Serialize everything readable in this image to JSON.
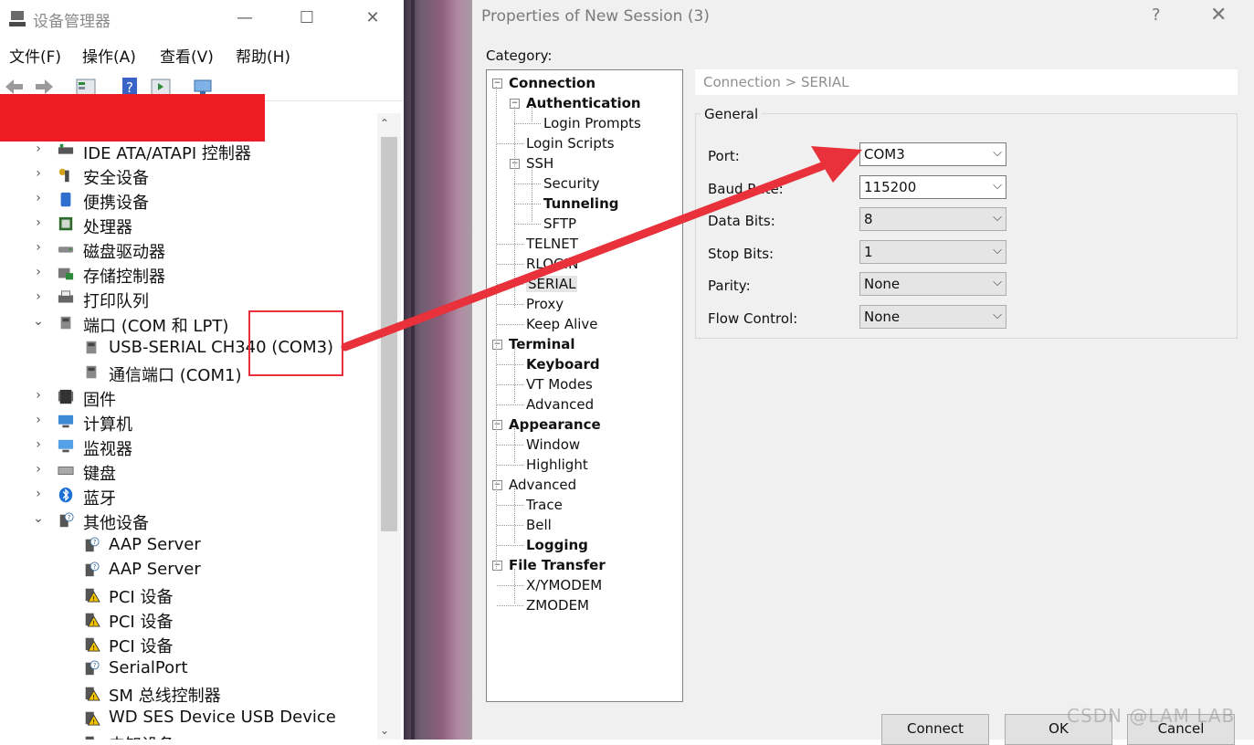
{
  "device_manager": {
    "title": "设备管理器",
    "window_buttons": {
      "minimize": "—",
      "maximize": "☐",
      "close": "✕"
    },
    "menu": [
      "文件(F)",
      "操作(A)",
      "查看(V)",
      "帮助(H)"
    ],
    "tree": [
      {
        "label": "IDE ATA/ATAPI 控制器",
        "expander": "›",
        "icon": "ide-controller-icon"
      },
      {
        "label": "安全设备",
        "expander": "›",
        "icon": "security-key-icon"
      },
      {
        "label": "便携设备",
        "expander": "›",
        "icon": "portable-device-icon"
      },
      {
        "label": "处理器",
        "expander": "›",
        "icon": "processor-icon"
      },
      {
        "label": "磁盘驱动器",
        "expander": "›",
        "icon": "disk-drive-icon"
      },
      {
        "label": "存储控制器",
        "expander": "›",
        "icon": "storage-controller-icon"
      },
      {
        "label": "打印队列",
        "expander": "›",
        "icon": "printer-icon"
      },
      {
        "label": "端口 (COM 和 LPT)",
        "expander": "⌄",
        "icon": "port-icon"
      },
      {
        "label": "USB-SERIAL CH340 (COM3)",
        "expander": "",
        "icon": "port-icon"
      },
      {
        "label": "通信端口 (COM1)",
        "expander": "",
        "icon": "port-icon"
      },
      {
        "label": "固件",
        "expander": "›",
        "icon": "firmware-icon"
      },
      {
        "label": "计算机",
        "expander": "›",
        "icon": "computer-icon"
      },
      {
        "label": "监视器",
        "expander": "›",
        "icon": "monitor-icon"
      },
      {
        "label": "键盘",
        "expander": "›",
        "icon": "keyboard-icon"
      },
      {
        "label": "蓝牙",
        "expander": "›",
        "icon": "bluetooth-icon"
      },
      {
        "label": "其他设备",
        "expander": "⌄",
        "icon": "unknown-device-icon"
      },
      {
        "label": "AAP Server",
        "expander": "",
        "icon": "unknown-device-icon"
      },
      {
        "label": "AAP Server",
        "expander": "",
        "icon": "unknown-device-icon"
      },
      {
        "label": "PCI 设备",
        "expander": "",
        "icon": "warning-device-icon"
      },
      {
        "label": "PCI 设备",
        "expander": "",
        "icon": "warning-device-icon"
      },
      {
        "label": "PCI 设备",
        "expander": "",
        "icon": "warning-device-icon"
      },
      {
        "label": "SerialPort",
        "expander": "",
        "icon": "unknown-device-icon"
      },
      {
        "label": "SM 总线控制器",
        "expander": "",
        "icon": "warning-device-icon"
      },
      {
        "label": "WD SES Device USB Device",
        "expander": "",
        "icon": "warning-device-icon"
      },
      {
        "label": "未知设备",
        "expander": "",
        "icon": "warning-device-icon"
      }
    ]
  },
  "properties": {
    "title": "Properties of New Session (3)",
    "help": "?",
    "close": "✕",
    "category_label": "Category:",
    "categories": [
      {
        "label": "Connection",
        "bold": true,
        "depth": 0,
        "toggle": "−"
      },
      {
        "label": "Authentication",
        "bold": true,
        "depth": 1,
        "toggle": "−"
      },
      {
        "label": "Login Prompts",
        "bold": false,
        "depth": 2,
        "toggle": ""
      },
      {
        "label": "Login Scripts",
        "bold": false,
        "depth": 1,
        "toggle": ""
      },
      {
        "label": "SSH",
        "bold": false,
        "depth": 1,
        "toggle": "−"
      },
      {
        "label": "Security",
        "bold": false,
        "depth": 2,
        "toggle": ""
      },
      {
        "label": "Tunneling",
        "bold": true,
        "depth": 2,
        "toggle": ""
      },
      {
        "label": "SFTP",
        "bold": false,
        "depth": 2,
        "toggle": ""
      },
      {
        "label": "TELNET",
        "bold": false,
        "depth": 1,
        "toggle": ""
      },
      {
        "label": "RLOGIN",
        "bold": false,
        "depth": 1,
        "toggle": ""
      },
      {
        "label": "SERIAL",
        "bold": false,
        "depth": 1,
        "toggle": "",
        "selected": true
      },
      {
        "label": "Proxy",
        "bold": false,
        "depth": 1,
        "toggle": ""
      },
      {
        "label": "Keep Alive",
        "bold": false,
        "depth": 1,
        "toggle": ""
      },
      {
        "label": "Terminal",
        "bold": true,
        "depth": 0,
        "toggle": "−"
      },
      {
        "label": "Keyboard",
        "bold": true,
        "depth": 1,
        "toggle": ""
      },
      {
        "label": "VT Modes",
        "bold": false,
        "depth": 1,
        "toggle": ""
      },
      {
        "label": "Advanced",
        "bold": false,
        "depth": 1,
        "toggle": ""
      },
      {
        "label": "Appearance",
        "bold": true,
        "depth": 0,
        "toggle": "−"
      },
      {
        "label": "Window",
        "bold": false,
        "depth": 1,
        "toggle": ""
      },
      {
        "label": "Highlight",
        "bold": false,
        "depth": 1,
        "toggle": ""
      },
      {
        "label": "Advanced",
        "bold": false,
        "depth": 0,
        "toggle": "−"
      },
      {
        "label": "Trace",
        "bold": false,
        "depth": 1,
        "toggle": ""
      },
      {
        "label": "Bell",
        "bold": false,
        "depth": 1,
        "toggle": ""
      },
      {
        "label": "Logging",
        "bold": true,
        "depth": 1,
        "toggle": ""
      },
      {
        "label": "File Transfer",
        "bold": true,
        "depth": 0,
        "toggle": "−"
      },
      {
        "label": "X/YMODEM",
        "bold": false,
        "depth": 1,
        "toggle": ""
      },
      {
        "label": "ZMODEM",
        "bold": false,
        "depth": 1,
        "toggle": ""
      }
    ],
    "breadcrumb": "Connection > SERIAL",
    "group_title": "General",
    "fields": [
      {
        "label": "Port:",
        "value": "COM3",
        "active": true
      },
      {
        "label": "Baud Rate:",
        "value": "115200",
        "active": true
      },
      {
        "label": "Data Bits:",
        "value": "8",
        "active": false
      },
      {
        "label": "Stop Bits:",
        "value": "1",
        "active": false
      },
      {
        "label": "Parity:",
        "value": "None",
        "active": false
      },
      {
        "label": "Flow Control:",
        "value": "None",
        "active": false
      }
    ],
    "dropdown_glyph": "⌵",
    "buttons": {
      "connect": "Connect",
      "ok": "OK",
      "cancel": "Cancel"
    }
  },
  "watermark": "CSDN @LAM LAB",
  "annotation_color": "#e8313a"
}
